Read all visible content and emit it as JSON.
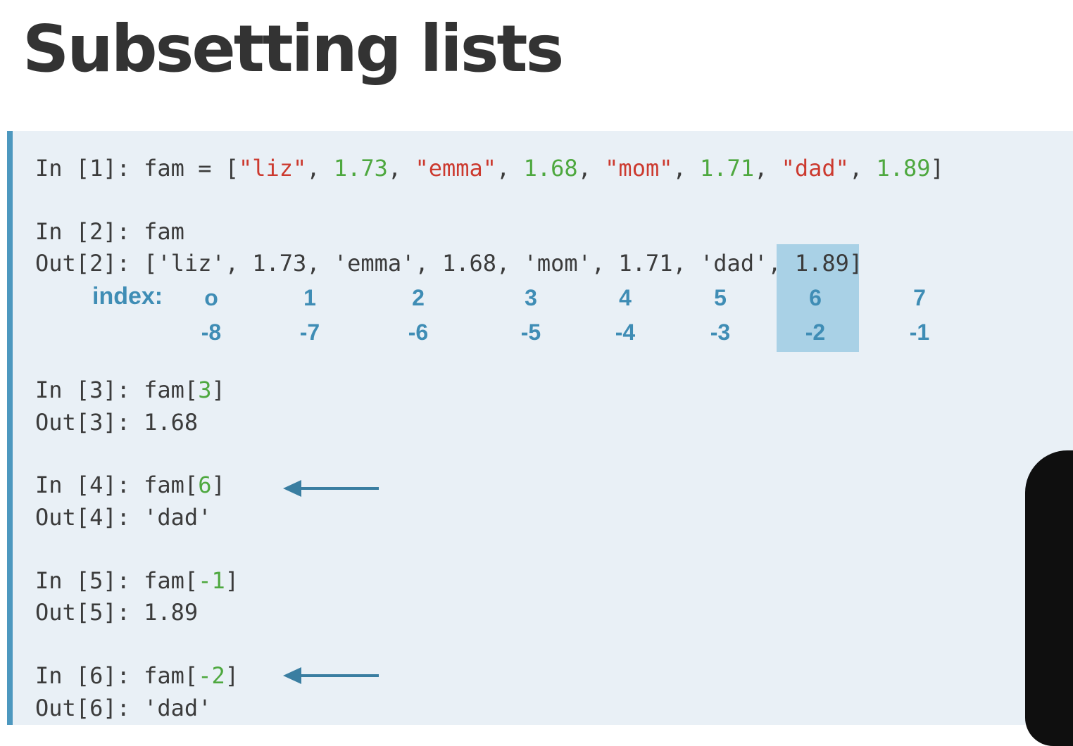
{
  "slide": {
    "title": "Subsetting lists"
  },
  "cells": {
    "in1": {
      "prompt": "In [1]: ",
      "code": "fam = [",
      "list": [
        {
          "t": "\"liz\"",
          "k": "str"
        },
        {
          "t": ", ",
          "k": "dim"
        },
        {
          "t": "1.73",
          "k": "num"
        },
        {
          "t": ", ",
          "k": "dim"
        },
        {
          "t": "\"emma\"",
          "k": "str"
        },
        {
          "t": ", ",
          "k": "dim"
        },
        {
          "t": "1.68",
          "k": "num"
        },
        {
          "t": ", ",
          "k": "dim"
        },
        {
          "t": "\"mom\"",
          "k": "str"
        },
        {
          "t": ", ",
          "k": "dim"
        },
        {
          "t": "1.71",
          "k": "num"
        },
        {
          "t": ", ",
          "k": "dim"
        },
        {
          "t": "\"dad\"",
          "k": "str"
        },
        {
          "t": ", ",
          "k": "dim"
        },
        {
          "t": "1.89",
          "k": "num"
        },
        {
          "t": "]",
          "k": "dim"
        }
      ]
    },
    "in2": {
      "line": "In [2]: fam"
    },
    "out2": {
      "line": "Out[2]: ['liz', 1.73, 'emma', 1.68, 'mom', 1.71, 'dad', 1.89]"
    },
    "index_label": "index:",
    "positive_index": [
      "o",
      "1",
      "2",
      "3",
      "4",
      "5",
      "6",
      "7"
    ],
    "negative_index": [
      "-8",
      "-7",
      "-6",
      "-5",
      "-4",
      "-3",
      "-2",
      "-1"
    ],
    "highlighted_index": 6,
    "in3": {
      "prompt": "In [3]: fam[",
      "arg": "3",
      "close": "]"
    },
    "out3": {
      "line": "Out[3]: 1.68"
    },
    "in4": {
      "prompt": "In [4]: fam[",
      "arg": "6",
      "close": "]"
    },
    "out4": {
      "line": "Out[4]: 'dad'"
    },
    "in5": {
      "prompt": "In [5]: fam[",
      "arg": "-1",
      "close": "]"
    },
    "out5": {
      "line": "Out[5]: 1.89"
    },
    "in6": {
      "prompt": "In [6]: fam[",
      "arg": "-2",
      "close": "]"
    },
    "out6": {
      "line": "Out[6]: 'dad'"
    }
  },
  "colors": {
    "accent": "#4d98bf",
    "panel": "#e9f0f6",
    "highlight": "#a9d1e6",
    "string": "#cc3a2f",
    "number": "#4ea83f",
    "index": "#3f8db5"
  }
}
